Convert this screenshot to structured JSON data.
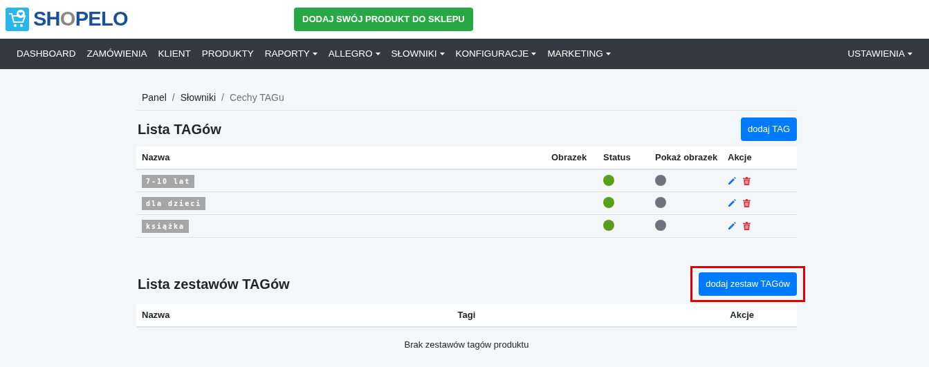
{
  "logo": {
    "parts": [
      {
        "text": "SH",
        "accent": false
      },
      {
        "text": "O",
        "accent": true
      },
      {
        "text": "PELO",
        "accent": false
      }
    ]
  },
  "header_button": "DODAJ SWÓJ PRODUKT DO SKLEPU",
  "nav": {
    "items": [
      {
        "label": "DASHBOARD",
        "dropdown": false
      },
      {
        "label": "ZAMÓWIENIA",
        "dropdown": false
      },
      {
        "label": "KLIENT",
        "dropdown": false
      },
      {
        "label": "PRODUKTY",
        "dropdown": false
      },
      {
        "label": "RAPORTY",
        "dropdown": true
      },
      {
        "label": "ALLEGRO",
        "dropdown": true
      },
      {
        "label": "SŁOWNIKI",
        "dropdown": true
      },
      {
        "label": "KONFIGURACJE",
        "dropdown": true
      },
      {
        "label": "MARKETING",
        "dropdown": true
      }
    ],
    "right": {
      "label": "USTAWIENIA",
      "dropdown": true
    }
  },
  "breadcrumb": [
    {
      "label": "Panel",
      "current": false
    },
    {
      "separator": "/",
      "label": "Słowniki",
      "current": false
    },
    {
      "separator": "/",
      "label": "Cechy TAGu",
      "current": true
    }
  ],
  "tags": {
    "title": "Lista TAGów",
    "add_button": {
      "label": "dodaj TAG",
      "highlighted": false
    },
    "columns": [
      "Nazwa",
      "Obrazek",
      "Status",
      "Pokaż obrazek",
      "Akcje"
    ],
    "rows": [
      {
        "name": "7-10 lat",
        "status": true,
        "show_image": false
      },
      {
        "name": "dla dzieci",
        "status": true,
        "show_image": false
      },
      {
        "name": "książka",
        "status": true,
        "show_image": false
      }
    ]
  },
  "sets": {
    "title": "Lista zestawów TAGów",
    "add_button": {
      "label": "dodaj zestaw TAGów",
      "highlighted": true
    },
    "columns": [
      "Nazwa",
      "Tagi",
      "Akcje"
    ],
    "empty": "Brak zestawów tagów produktu"
  }
}
